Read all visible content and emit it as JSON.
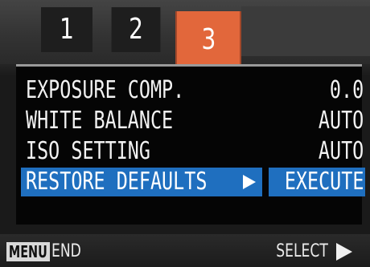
{
  "tabs": [
    {
      "label": "1",
      "active": false
    },
    {
      "label": "2",
      "active": false
    },
    {
      "label": "3",
      "active": true
    }
  ],
  "settings": [
    {
      "label": "EXPOSURE COMP.",
      "value": "0.0"
    },
    {
      "label": "WHITE BALANCE",
      "value": "AUTO"
    },
    {
      "label": "ISO SETTING",
      "value": "AUTO"
    },
    {
      "label": "RESTORE DEFAULTS",
      "value": "EXECUTE",
      "selected": true
    }
  ],
  "footer": {
    "menu_key": "MENU",
    "end_label": "END",
    "select_label": "SELECT"
  },
  "icons": {
    "row_arrow": "arrow-right-icon",
    "select_arrow": "arrow-right-icon"
  },
  "colors": {
    "active_tab": "#e2673b",
    "selection": "#1f6fbf"
  }
}
